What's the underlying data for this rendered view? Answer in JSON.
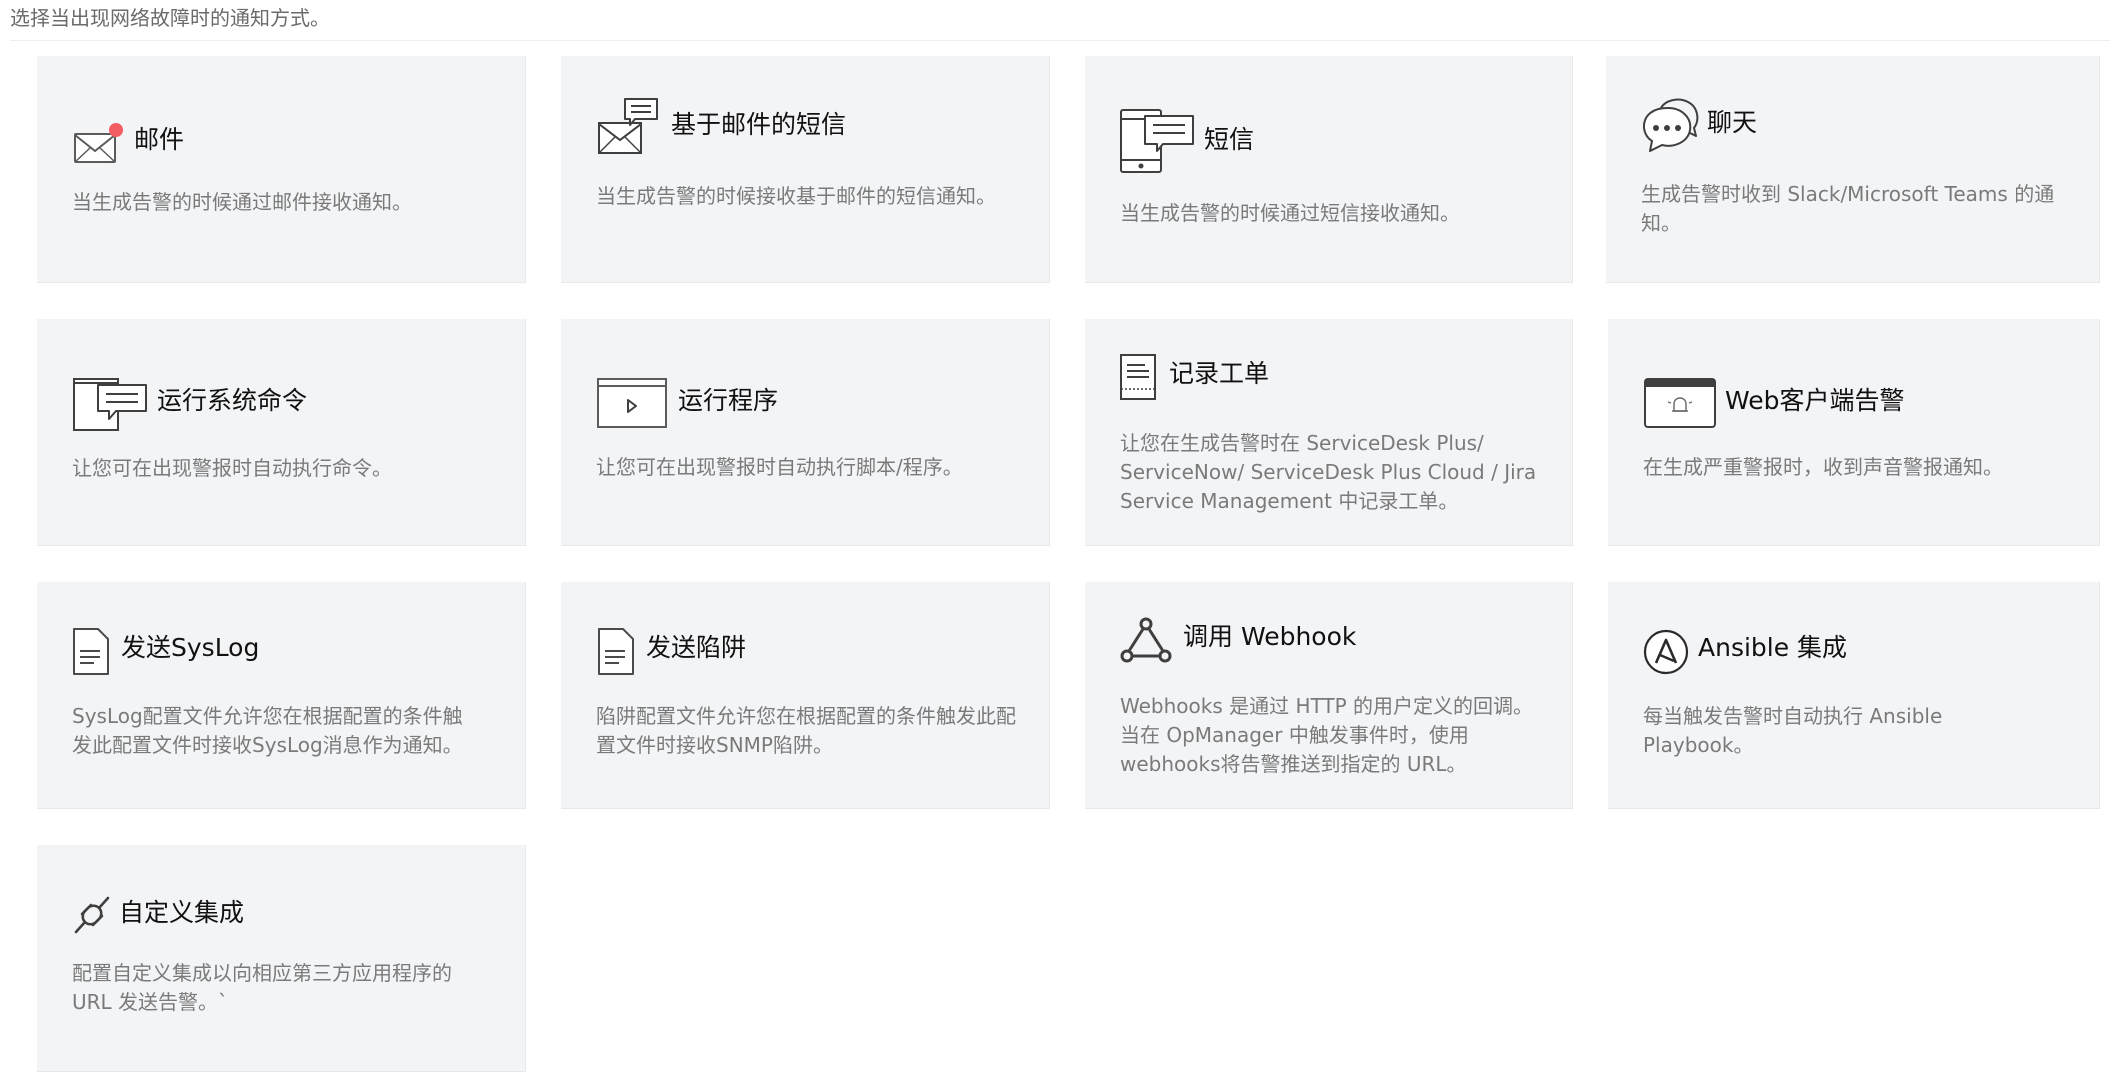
{
  "page": {
    "header": "选择当出现网络故障时的通知方式。"
  },
  "colors": {
    "card_background": "#f3f4f6",
    "title_text": "#111111",
    "description_text": "#7a7a7a",
    "mail_badge": "#f25c62"
  },
  "cards": [
    {
      "icon": "envelope-icon",
      "title": "邮件",
      "description": "当生成告警的时候通过邮件接收通知。"
    },
    {
      "icon": "email-sms-icon",
      "title": "基于邮件的短信",
      "description": "当生成告警的时候接收基于邮件的短信通知。"
    },
    {
      "icon": "mobile-sms-icon",
      "title": "短信",
      "description": "当生成告警的时候通过短信接收通知。"
    },
    {
      "icon": "chat-bubble-icon",
      "title": "聊天",
      "description": "生成告警时收到 Slack/Microsoft Teams 的通知。"
    },
    {
      "icon": "command-window-icon",
      "title": "运行系统命令",
      "description": "让您可在出现警报时自动执行命令。"
    },
    {
      "icon": "run-program-icon",
      "title": "运行程序",
      "description": "让您可在出现警报时自动执行脚本/程序。"
    },
    {
      "icon": "ticket-document-icon",
      "title": "记录工单",
      "description": "让您在生成告警时在 ServiceDesk Plus/ ServiceNow/ ServiceDesk Plus Cloud / Jira Service Management 中记录工单。"
    },
    {
      "icon": "browser-alarm-icon",
      "title": "Web客户端告警",
      "description": "在生成严重警报时，收到声音警报通知。"
    },
    {
      "icon": "syslog-document-icon",
      "title": "发送SysLog",
      "description": "SysLog配置文件允许您在根据配置的条件触发此配置文件时接收SysLog消息作为通知。"
    },
    {
      "icon": "trap-document-icon",
      "title": "发送陷阱",
      "description": "陷阱配置文件允许您在根据配置的条件触发此配置文件时接收SNMP陷阱。"
    },
    {
      "icon": "webhook-icon",
      "title": "调用 Webhook",
      "description": "Webhooks 是通过 HTTP 的用户定义的回调。 当在 OpManager 中触发事件时，使用 webhooks将告警推送到指定的 URL。"
    },
    {
      "icon": "ansible-icon",
      "title": "Ansible 集成",
      "description": "每当触发告警时自动执行 Ansible Playbook。"
    },
    {
      "icon": "custom-integration-icon",
      "title": "自定义集成",
      "description": "配置自定义集成以向相应第三方应用程序的 URL 发送告警。`"
    }
  ]
}
